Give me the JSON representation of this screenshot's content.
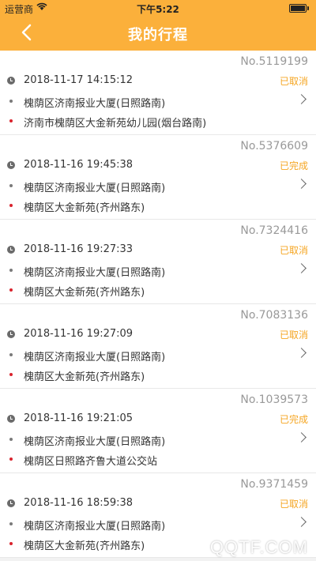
{
  "status_bar": {
    "carrier": "运营商",
    "time": "下午5:22"
  },
  "nav": {
    "title": "我的行程"
  },
  "trips": [
    {
      "number": "No.5119199",
      "datetime": "2018-11-17 14:15:12",
      "status": "已取消",
      "from": "槐荫区济南报业大厦(日照路南)",
      "to": "济南市槐荫区大金新苑幼儿园(烟台路南)"
    },
    {
      "number": "No.5376609",
      "datetime": "2018-11-16 19:45:38",
      "status": "已完成",
      "from": "槐荫区济南报业大厦(日照路南)",
      "to": "槐荫区大金新苑(齐州路东)"
    },
    {
      "number": "No.7324416",
      "datetime": "2018-11-16 19:27:33",
      "status": "已取消",
      "from": "槐荫区济南报业大厦(日照路南)",
      "to": "槐荫区大金新苑(齐州路东)"
    },
    {
      "number": "No.7083136",
      "datetime": "2018-11-16 19:27:09",
      "status": "已取消",
      "from": "槐荫区济南报业大厦(日照路南)",
      "to": "槐荫区大金新苑(齐州路东)"
    },
    {
      "number": "No.1039573",
      "datetime": "2018-11-16 19:21:05",
      "status": "已完成",
      "from": "槐荫区济南报业大厦(日照路南)",
      "to": "槐荫区日照路齐鲁大道公交站"
    },
    {
      "number": "No.9371459",
      "datetime": "2018-11-16 18:59:38",
      "status": "已取消",
      "from": "槐荫区济南报业大厦(日照路南)",
      "to": "槐荫区大金新苑(齐州路东)"
    }
  ],
  "watermark": "QQTF.COM",
  "colors": {
    "header": "#fbb03b",
    "status": "#f5a623",
    "end_dot": "#d9232d"
  }
}
